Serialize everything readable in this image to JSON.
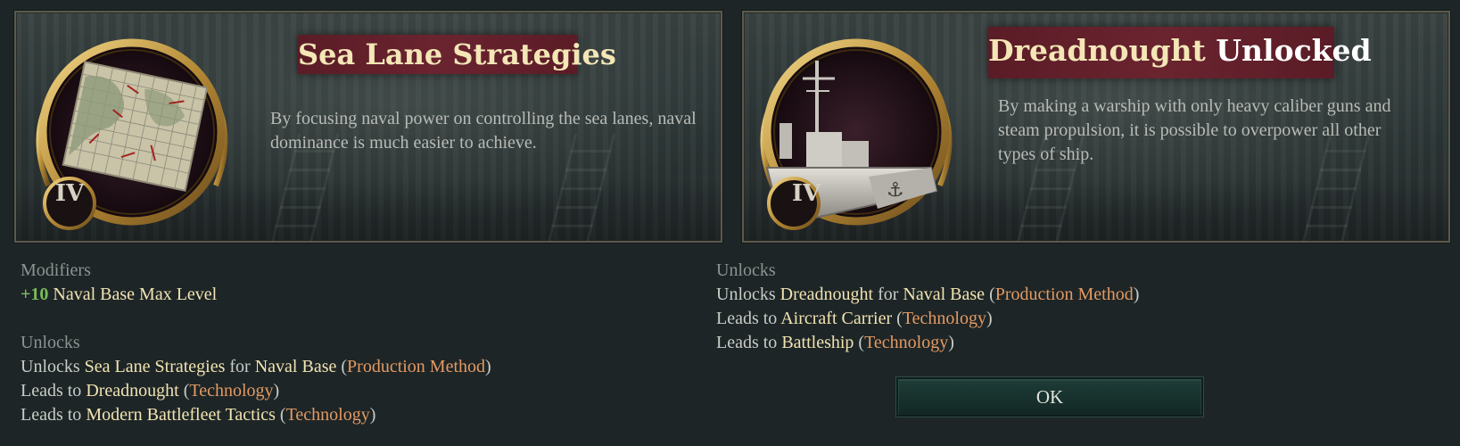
{
  "left_event": {
    "title": "Sea Lane Strategies",
    "tier_badge": "IV",
    "icon": "map-icon",
    "description": "By focusing naval power on controlling the sea lanes, naval dominance is much easier to achieve.",
    "modifiers": {
      "heading": "Modifiers",
      "items": [
        {
          "value": "+10",
          "label": "Naval Base Max Level"
        }
      ]
    },
    "unlocks": {
      "heading": "Unlocks",
      "line1": {
        "prefix": "Unlocks ",
        "item": "Sea Lane Strategies",
        "mid": " for ",
        "target": "Naval Base",
        "open": " (",
        "type": "Production Method",
        "close": ")"
      },
      "line2": {
        "prefix": "Leads to ",
        "item": "Dreadnought",
        "open": " (",
        "type": "Technology",
        "close": ")"
      },
      "line3": {
        "prefix": "Leads to ",
        "item": "Modern Battlefleet Tactics",
        "open": " (",
        "type": "Technology",
        "close": ")"
      }
    }
  },
  "right_event": {
    "title_word1": "Dreadnought",
    "title_word2": "Unlocked",
    "tier_badge": "IV",
    "icon": "battleship-icon",
    "description": "By making a warship with only heavy caliber guns and steam propulsion, it is possible to overpower all other types of ship.",
    "unlocks": {
      "heading": "Unlocks",
      "line1": {
        "prefix": "Unlocks ",
        "item": "Dreadnought",
        "mid": " for ",
        "target": "Naval Base",
        "open": " (",
        "type": "Production Method",
        "close": ")"
      },
      "line2": {
        "prefix": "Leads to ",
        "item": "Aircraft Carrier",
        "open": " (",
        "type": "Technology",
        "close": ")"
      },
      "line3": {
        "prefix": "Leads to ",
        "item": "Battleship",
        "open": " (",
        "type": "Technology",
        "close": ")"
      }
    },
    "ok_label": "OK"
  },
  "colors": {
    "background": "#1d2527",
    "title_plate": "#6a2430",
    "title_text": "#f4e6b6",
    "highlight": "#f2e3b1",
    "link": "#e39a62",
    "positive": "#7cbb5c",
    "gold_frame": "#c9a24e",
    "ok_button": "#1f3d38"
  }
}
